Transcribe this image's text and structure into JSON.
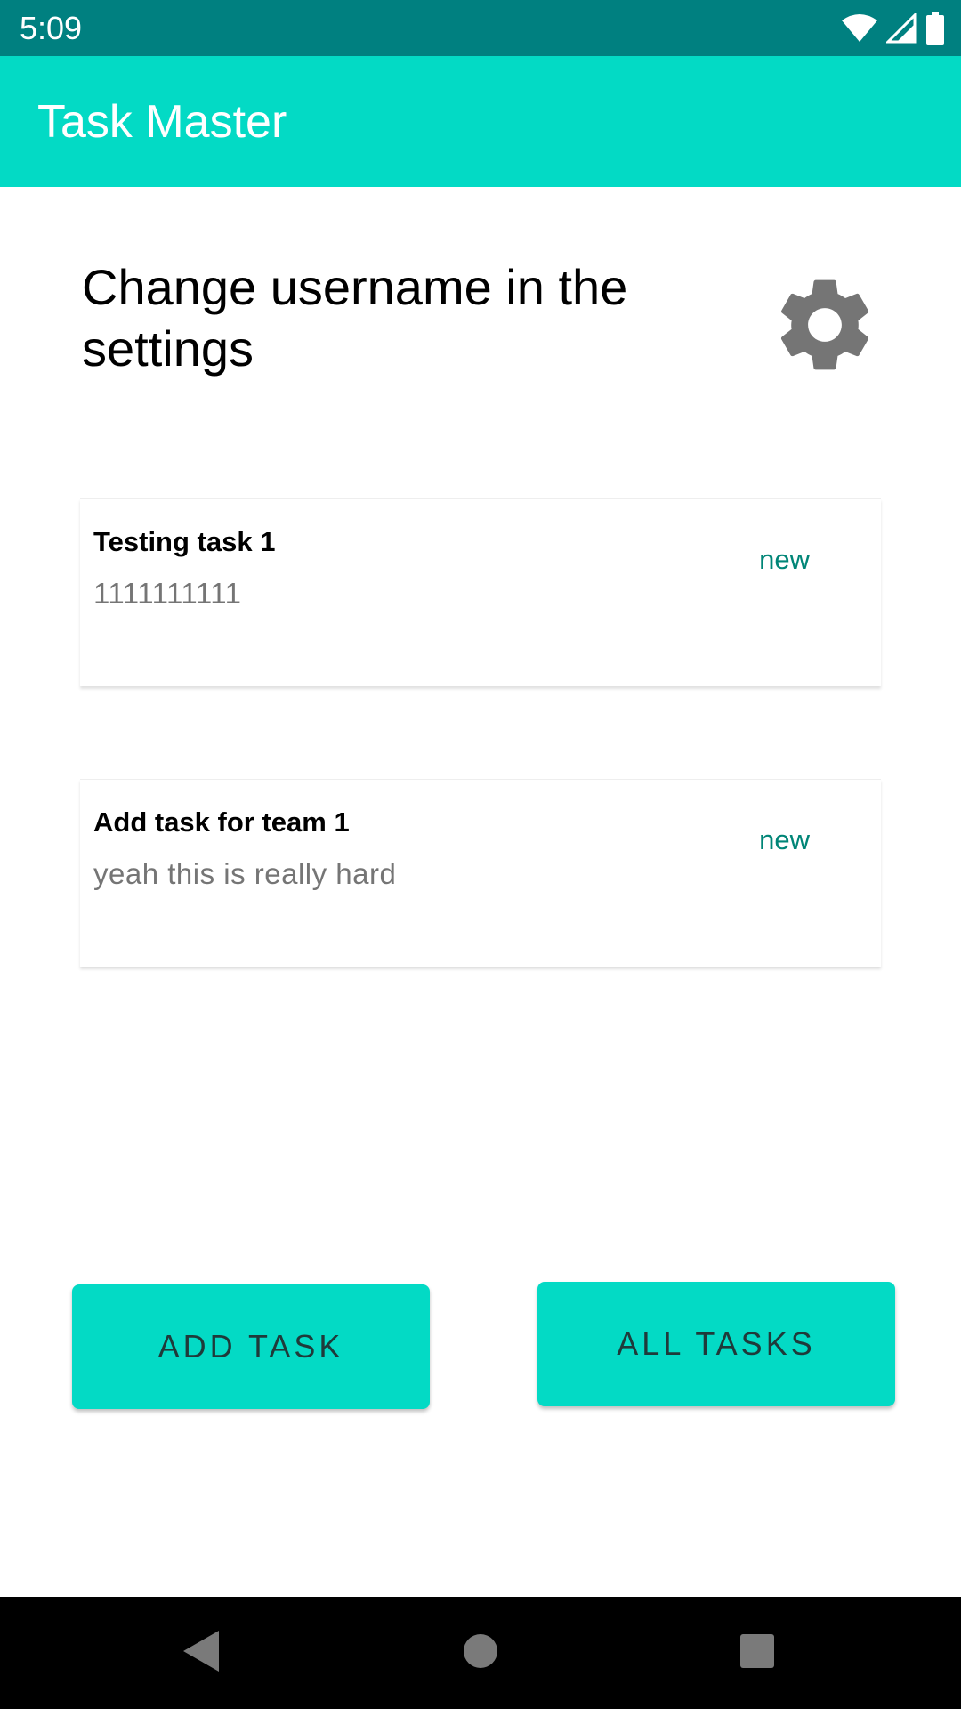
{
  "status_bar": {
    "time": "5:09",
    "icons": [
      "wifi-icon",
      "cell-signal-icon",
      "battery-icon"
    ]
  },
  "app_bar": {
    "title": "Task Master"
  },
  "header": {
    "text": "Change username in the settings",
    "settings_icon": "gear-icon"
  },
  "tasks": [
    {
      "title": "Testing task 1",
      "body": "1111111111",
      "state": "new"
    },
    {
      "title": "Add task for team 1",
      "body": "yeah this is really hard",
      "state": "new"
    }
  ],
  "buttons": {
    "add_task": "ADD TASK",
    "all_tasks": "ALL TASKS"
  },
  "nav_bar": {
    "icons": [
      "back-icon",
      "home-icon",
      "recents-icon"
    ]
  },
  "colors": {
    "status_bar": "#008080",
    "accent": "#03DAC5",
    "state_text": "#008577"
  }
}
